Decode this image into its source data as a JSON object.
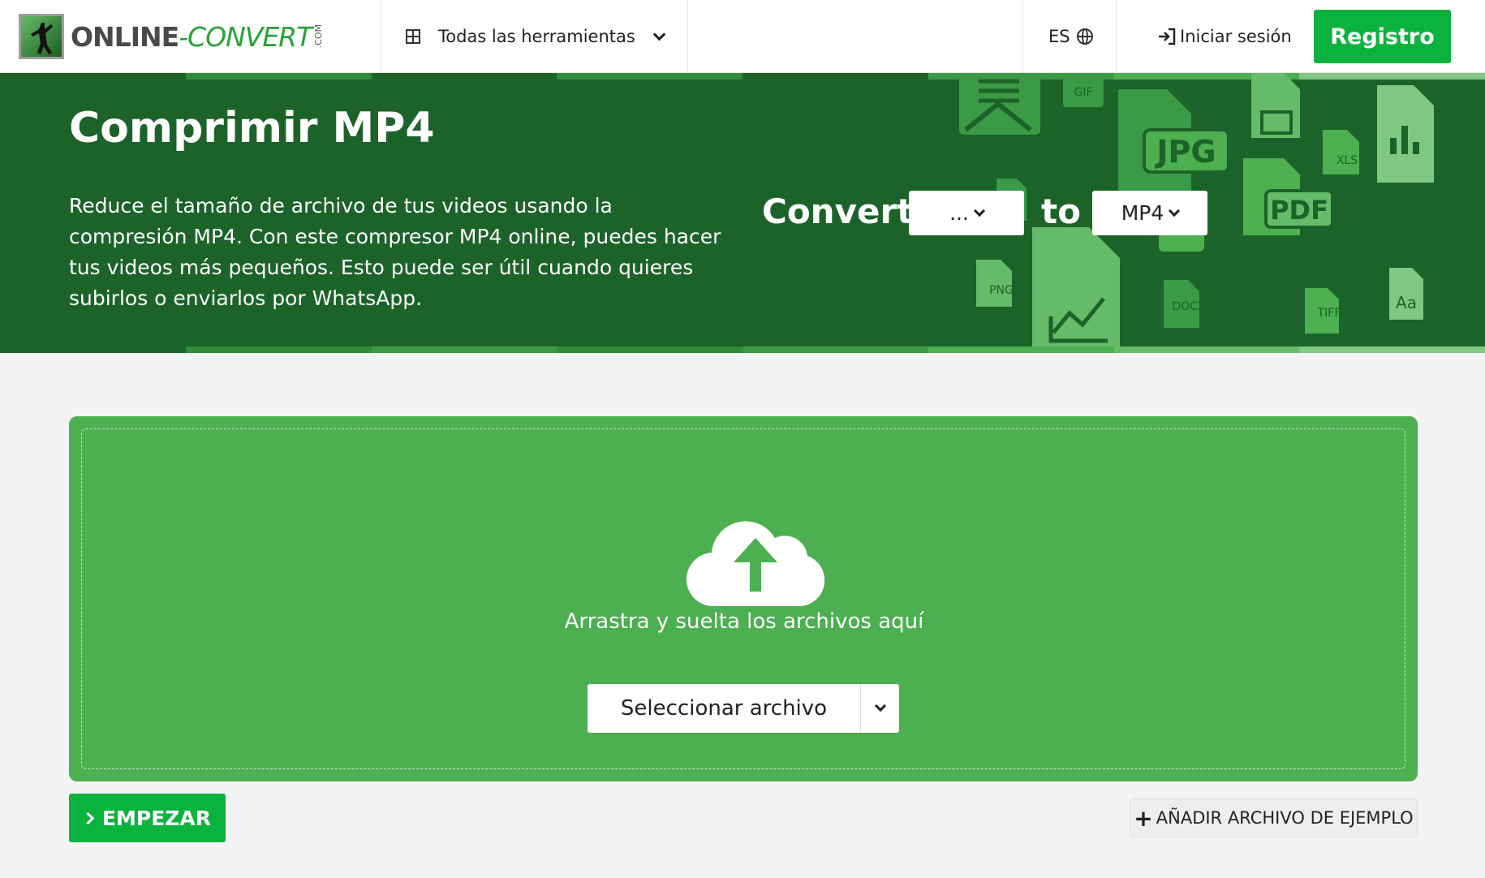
{
  "brand": {
    "name_part1": "ONLINE",
    "name_part2": "-CONVERT",
    "suffix": ".COM"
  },
  "nav": {
    "tools_label": "Todas las herramientas",
    "language": "ES",
    "login_label": "Iniciar sesión",
    "register_label": "Registro"
  },
  "hero": {
    "title": "Comprimir MP4",
    "description": "Reduce el tamaño de archivo de tus videos usando la compresión MP4. Con este compresor MP4 online, puedes hacer tus videos más pequeños. Esto puede ser útil cuando quieres subirlos o enviarlos por WhatsApp.",
    "convert_label": "Convert",
    "from_value": "...",
    "to_label": "to",
    "to_value": "MP4",
    "file_icons": [
      "GIF",
      "JPG",
      "XLS",
      "PDF",
      "PNG",
      "DOCX",
      "TIFF",
      "Aa"
    ]
  },
  "upload": {
    "drop_text": "Arrastra y suelta los archivos aquí",
    "select_label": "Seleccionar archivo"
  },
  "actions": {
    "start_label": "EMPEZAR",
    "sample_label": "AÑADIR ARCHIVO DE EJEMPLO"
  },
  "colors": {
    "hero_bg": "#1c6329",
    "accent_green": "#0ab33d",
    "upload_bg": "#4caf50"
  }
}
